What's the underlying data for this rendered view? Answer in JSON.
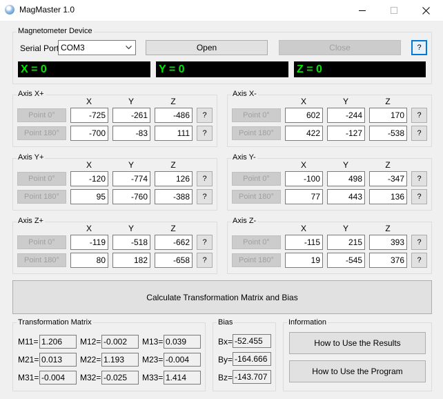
{
  "window": {
    "title": "MagMaster 1.0"
  },
  "device": {
    "group_label": "Magnetometer Device",
    "serial_port_label": "Serial Port:",
    "serial_port_value": "COM3",
    "open_label": "Open",
    "close_label": "Close",
    "help_label": "?",
    "display_x": "X = 0",
    "display_y": "Y = 0",
    "display_z": "Z = 0"
  },
  "axes_headers": {
    "x": "X",
    "y": "Y",
    "z": "Z"
  },
  "axes": [
    {
      "label": "Axis X+",
      "p0_label": "Point 0°",
      "p180_label": "Point 180°",
      "p0": [
        "-725",
        "-261",
        "-486"
      ],
      "p180": [
        "-700",
        "-83",
        "111"
      ],
      "help": "?"
    },
    {
      "label": "Axis X-",
      "p0_label": "Point 0°",
      "p180_label": "Point 180°",
      "p0": [
        "602",
        "-244",
        "170"
      ],
      "p180": [
        "422",
        "-127",
        "-538"
      ],
      "help": "?"
    },
    {
      "label": "Axis Y+",
      "p0_label": "Point 0°",
      "p180_label": "Point 180°",
      "p0": [
        "-120",
        "-774",
        "126"
      ],
      "p180": [
        "95",
        "-760",
        "-388"
      ],
      "help": "?"
    },
    {
      "label": "Axis Y-",
      "p0_label": "Point 0°",
      "p180_label": "Point 180°",
      "p0": [
        "-100",
        "498",
        "-347"
      ],
      "p180": [
        "77",
        "443",
        "136"
      ],
      "help": "?"
    },
    {
      "label": "Axis Z+",
      "p0_label": "Point 0°",
      "p180_label": "Point 180°",
      "p0": [
        "-119",
        "-518",
        "-662"
      ],
      "p180": [
        "80",
        "182",
        "-658"
      ],
      "help": "?"
    },
    {
      "label": "Axis Z-",
      "p0_label": "Point 0°",
      "p180_label": "Point 180°",
      "p0": [
        "-115",
        "215",
        "393"
      ],
      "p180": [
        "19",
        "-545",
        "376"
      ],
      "help": "?"
    }
  ],
  "calculate_label": "Calculate Transformation Matrix and Bias",
  "matrix": {
    "group_label": "Transformation Matrix",
    "cells": [
      {
        "label": "M11=",
        "value": "1.206"
      },
      {
        "label": "M12=",
        "value": "-0.002"
      },
      {
        "label": "M13=",
        "value": "0.039"
      },
      {
        "label": "M21=",
        "value": "0.013"
      },
      {
        "label": "M22=",
        "value": "1.193"
      },
      {
        "label": "M23=",
        "value": "-0.004"
      },
      {
        "label": "M31=",
        "value": "-0.004"
      },
      {
        "label": "M32=",
        "value": "-0.025"
      },
      {
        "label": "M33=",
        "value": "1.414"
      }
    ]
  },
  "bias": {
    "group_label": "Bias",
    "cells": [
      {
        "label": "Bx=",
        "value": "-52.455"
      },
      {
        "label": "By=",
        "value": "-164.666"
      },
      {
        "label": "Bz=",
        "value": "-143.707"
      }
    ]
  },
  "info": {
    "group_label": "Information",
    "results_label": "How to Use the Results",
    "program_label": "How to Use the Program"
  }
}
